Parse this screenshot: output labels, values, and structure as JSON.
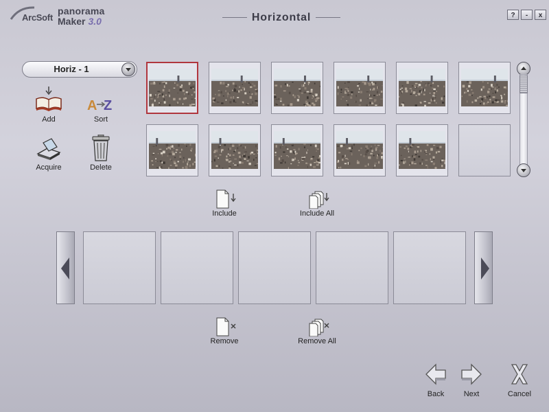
{
  "app": {
    "brand": "ArcSoft",
    "product_line1": "panorama",
    "product_line2": "Maker",
    "version": "3.0",
    "title": "Horizontal"
  },
  "window_controls": {
    "help": "?",
    "minimize": "-",
    "close": "x"
  },
  "project_select": {
    "value": "Horiz - 1"
  },
  "tools": {
    "add": "Add",
    "sort": "Sort",
    "acquire": "Acquire",
    "delete": "Delete"
  },
  "thumbnails": {
    "count_with_images": 11,
    "selected_index": 0,
    "rows": [
      [
        "photo",
        "photo",
        "photo",
        "photo",
        "photo",
        "photo"
      ],
      [
        "photo",
        "photo",
        "photo",
        "photo",
        "photo",
        "empty"
      ]
    ]
  },
  "actions": {
    "include": "Include",
    "include_all": "Include All",
    "remove": "Remove",
    "remove_all": "Remove All"
  },
  "stitch_slots": 5,
  "bottom_nav": {
    "back": "Back",
    "next": "Next",
    "cancel": "Cancel"
  },
  "icons": {
    "add": "open-book-icon",
    "sort": "a-to-z-icon",
    "acquire": "scanner-icon",
    "delete": "trash-can-icon",
    "include": "document-down-arrow-icon",
    "include_all": "documents-down-arrow-icon",
    "remove": "document-x-icon",
    "remove_all": "documents-x-icon",
    "back": "left-arrow-icon",
    "next": "right-arrow-icon",
    "cancel": "x-icon"
  },
  "colors": {
    "selection_border": "#b0363d",
    "background": "#c9c8d2",
    "version_accent": "#7a6fae"
  }
}
